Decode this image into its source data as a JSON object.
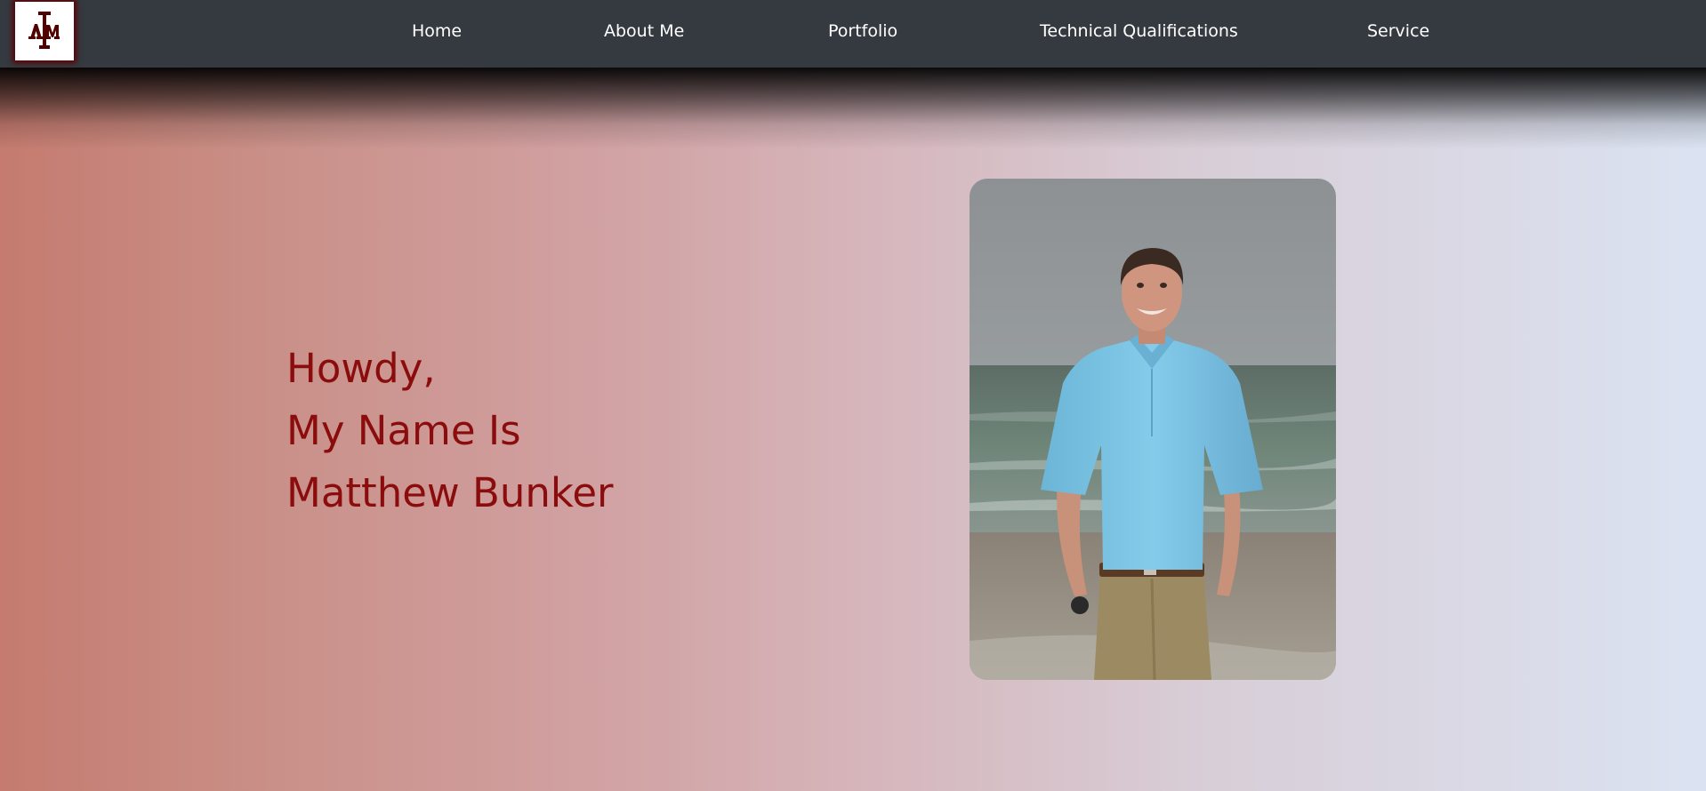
{
  "nav": {
    "logo_text": "ATM",
    "items": [
      {
        "label": "Home"
      },
      {
        "label": "About Me"
      },
      {
        "label": "Portfolio"
      },
      {
        "label": "Technical Qualifications"
      },
      {
        "label": "Service"
      }
    ]
  },
  "hero": {
    "line1": "Howdy,",
    "line2": "My Name Is",
    "line3": "Matthew Bunker"
  },
  "colors": {
    "navbar": "#343a40",
    "heading": "#8b0c0c",
    "logo_maroon": "#500000",
    "shirt": "#7ec6e6",
    "pants": "#9c8a63"
  }
}
